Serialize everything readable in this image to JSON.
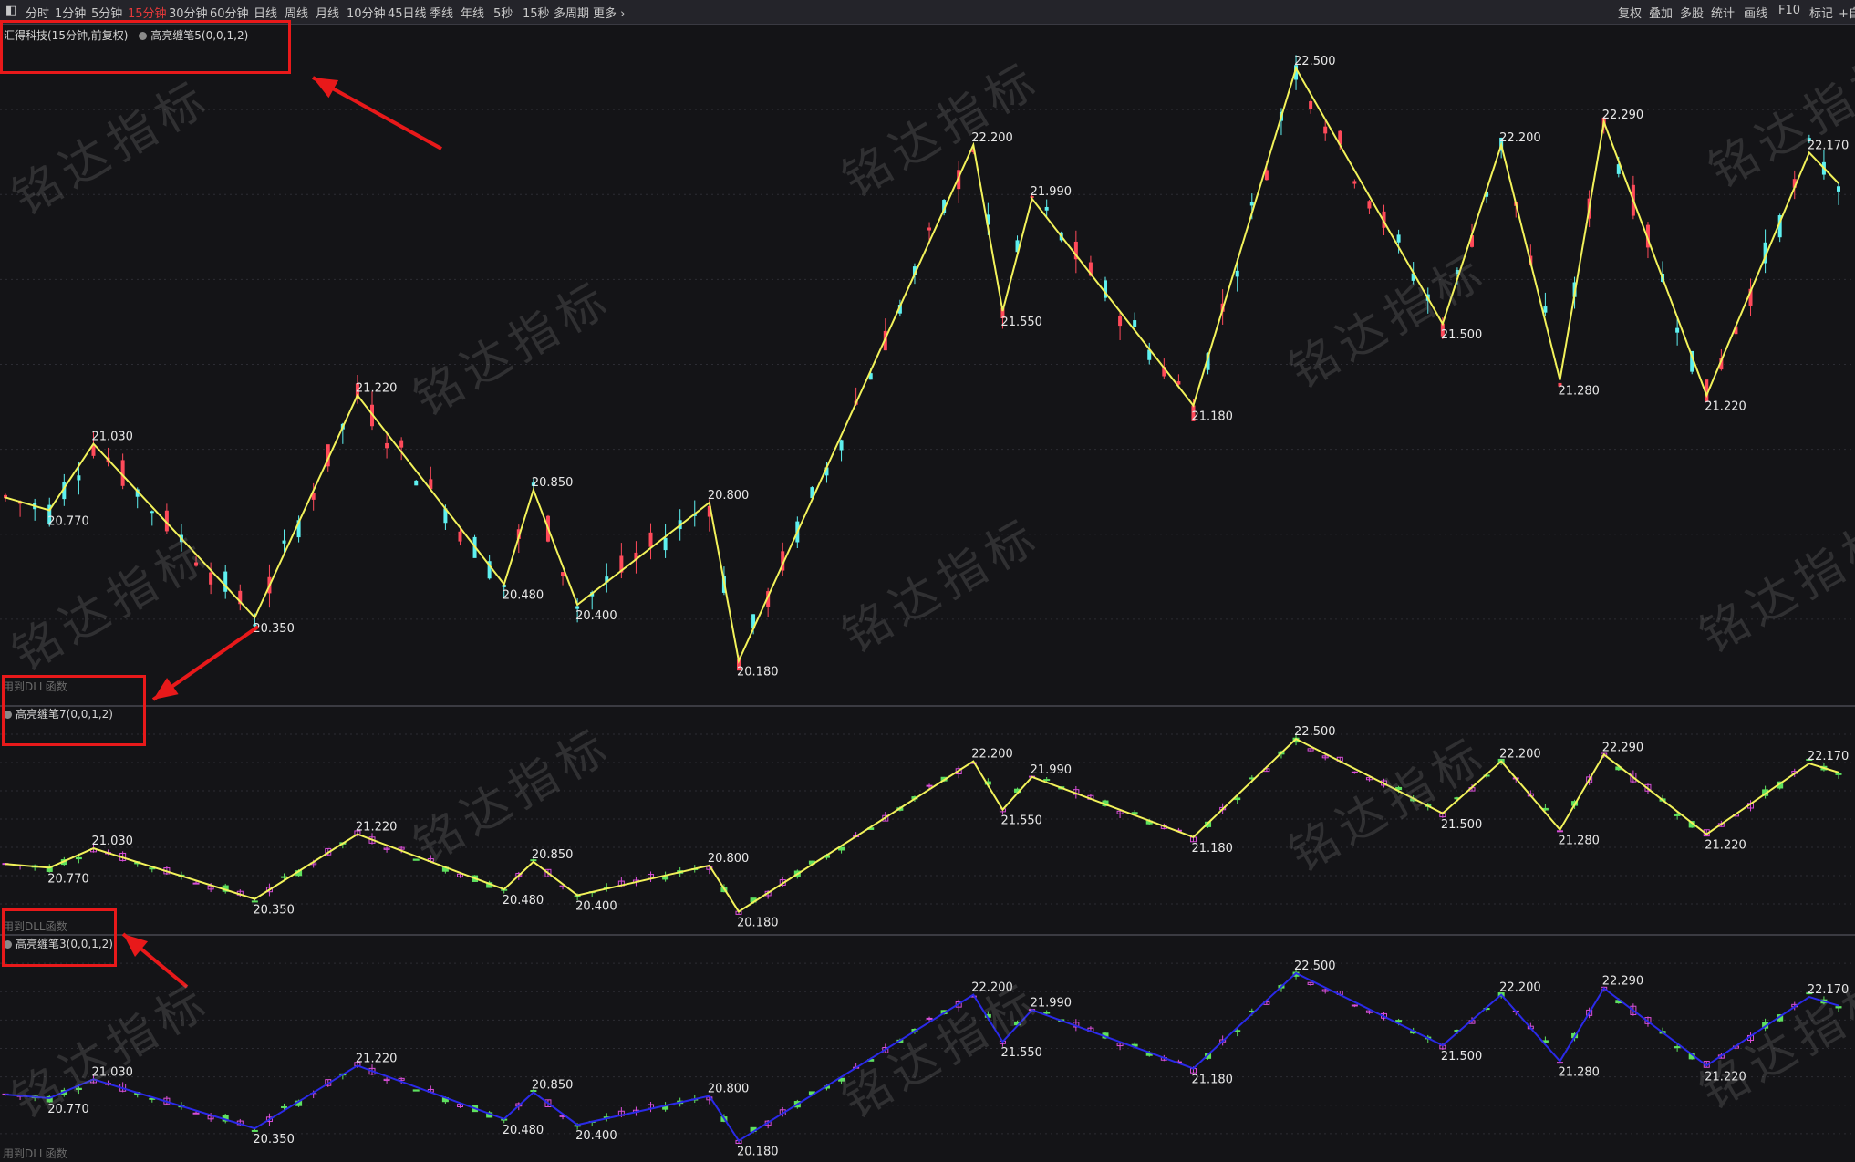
{
  "toolbar": {
    "periods": [
      "分时",
      "1分钟",
      "5分钟",
      "15分钟",
      "30分钟",
      "60分钟",
      "日线",
      "周线",
      "月线",
      "10分钟",
      "45日线",
      "季线",
      "年线",
      "5秒",
      "15秒",
      "多周期",
      "更多 ›"
    ],
    "active_period": "15分钟",
    "right_items": [
      "复权",
      "叠加",
      "多股",
      "统计",
      "画线",
      "F10",
      "标记",
      "+自"
    ]
  },
  "panes": {
    "main": {
      "title": "汇得科技(15分钟,前复权)",
      "indicator": "高亮缠笔5(0,0,1,2)",
      "dll_note": "用到DLL函数"
    },
    "sub1": {
      "indicator": "高亮缠笔7(0,0,1,2)",
      "dll_note": "用到DLL函数"
    },
    "sub2": {
      "indicator": "高亮缠笔3(0,0,1,2)",
      "dll_note": "用到DLL函数"
    }
  },
  "watermark_text": "铭达指标",
  "colors": {
    "up": "#ff4a5a",
    "down": "#5ef0f0",
    "sub_up": "#d84fd8",
    "sub_down": "#5fe05f",
    "stroke_main": "#f2f25a",
    "stroke_sub2": "#2a2ae8",
    "callout": "#e8191a"
  },
  "chart_data": {
    "type": "line",
    "title": "汇得科技(15分钟,前复权)",
    "price_range": [
      20.1,
      22.6
    ],
    "pivots": [
      {
        "index": 0,
        "value": 20.82
      },
      {
        "index": 3,
        "value": 20.77,
        "label": "20.770"
      },
      {
        "index": 6,
        "value": 21.03,
        "label": "21.030"
      },
      {
        "index": 17,
        "value": 20.35,
        "label": "20.350"
      },
      {
        "index": 24,
        "value": 21.22,
        "label": "21.220"
      },
      {
        "index": 34,
        "value": 20.48,
        "label": "20.480"
      },
      {
        "index": 36,
        "value": 20.85,
        "label": "20.850"
      },
      {
        "index": 39,
        "value": 20.4,
        "label": "20.400"
      },
      {
        "index": 48,
        "value": 20.8,
        "label": "20.800"
      },
      {
        "index": 50,
        "value": 20.18,
        "label": "20.180"
      },
      {
        "index": 66,
        "value": 22.2,
        "label": "22.200"
      },
      {
        "index": 68,
        "value": 21.55,
        "label": "21.550"
      },
      {
        "index": 70,
        "value": 21.99,
        "label": "21.990"
      },
      {
        "index": 81,
        "value": 21.18,
        "label": "21.180"
      },
      {
        "index": 88,
        "value": 22.5,
        "label": "22.500"
      },
      {
        "index": 98,
        "value": 21.5,
        "label": "21.500"
      },
      {
        "index": 102,
        "value": 22.2,
        "label": "22.200"
      },
      {
        "index": 106,
        "value": 21.28,
        "label": "21.280"
      },
      {
        "index": 109,
        "value": 22.29,
        "label": "22.290"
      },
      {
        "index": 116,
        "value": 21.22,
        "label": "21.220"
      },
      {
        "index": 123,
        "value": 22.17,
        "label": "22.170"
      },
      {
        "index": 125,
        "value": 22.05
      }
    ]
  }
}
